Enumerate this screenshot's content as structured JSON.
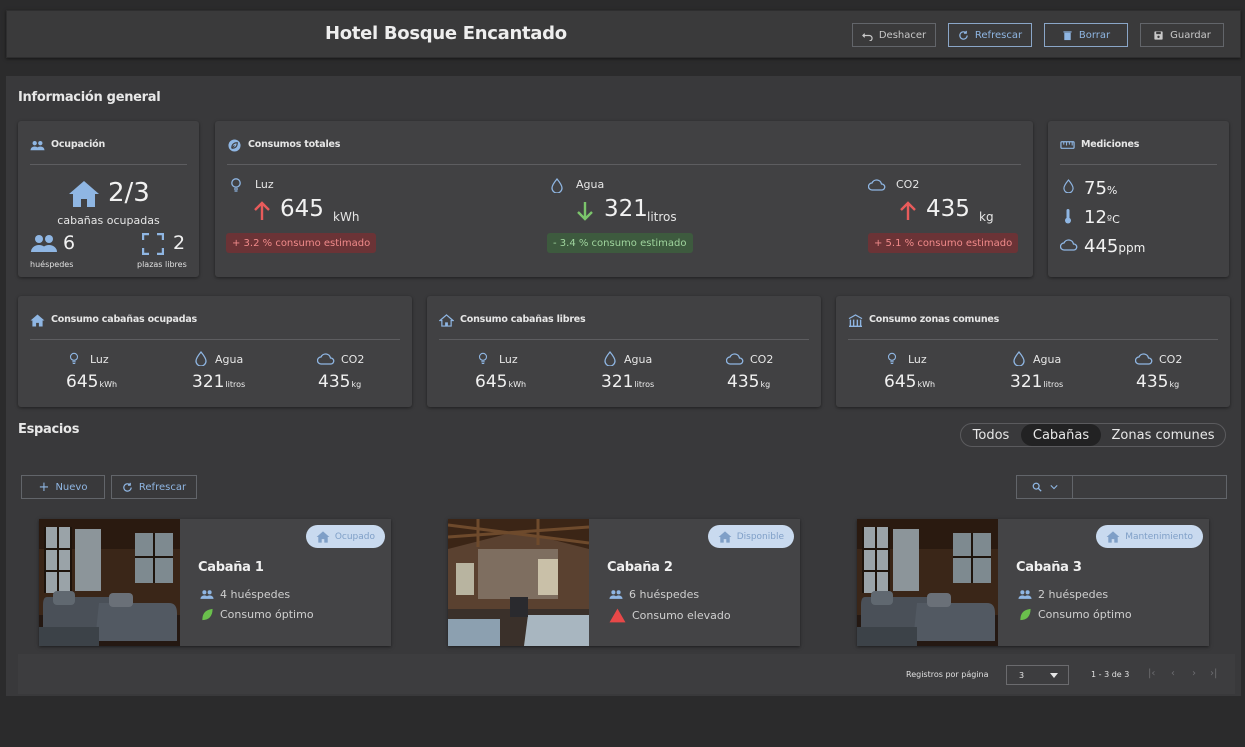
{
  "header": {
    "title": "Hotel Bosque Encantado",
    "undo": "Deshacer",
    "refresh": "Refrescar",
    "delete": "Borrar",
    "save": "Guardar"
  },
  "general": {
    "title": "Información general",
    "occupancy": {
      "title": "Ocupación",
      "cabins": "2/3",
      "cabins_label": "cabañas ocupadas",
      "guests": "6",
      "guests_label": "huéspedes",
      "free": "2",
      "free_label": "plazas libres"
    },
    "totals": {
      "title": "Consumos totales",
      "items": [
        {
          "label": "Luz",
          "value": "645",
          "unit": "kWh",
          "delta": "+ 3.2 % consumo estimado",
          "trend": "up"
        },
        {
          "label": "Agua",
          "value": "321",
          "unit": "litros",
          "delta": "- 3.4 % consumo estimado",
          "trend": "down"
        },
        {
          "label": "CO2",
          "value": "435",
          "unit": "kg",
          "delta": "+ 5.1 % consumo estimado",
          "trend": "up"
        }
      ]
    },
    "measures": {
      "title": "Mediciones",
      "humidity": "75",
      "humidity_unit": "%",
      "temp": "12",
      "temp_unit": "ºC",
      "co2": "445",
      "co2_unit": "ppm"
    },
    "groups": [
      {
        "title": "Consumo cabañas ocupadas",
        "luz": "Luz",
        "agua": "Agua",
        "co2": "CO2",
        "v1": "645",
        "u1": "kWh",
        "v2": "321",
        "u2": "litros",
        "v3": "435",
        "u3": "kg"
      },
      {
        "title": "Consumo cabañas libres",
        "luz": "Luz",
        "agua": "Agua",
        "co2": "CO2",
        "v1": "645",
        "u1": "kWh",
        "v2": "321",
        "u2": "litros",
        "v3": "435",
        "u3": "kg"
      },
      {
        "title": "Consumo zonas comunes",
        "luz": "Luz",
        "agua": "Agua",
        "co2": "CO2",
        "v1": "645",
        "u1": "kWh",
        "v2": "321",
        "u2": "litros",
        "v3": "435",
        "u3": "kg"
      }
    ]
  },
  "spaces": {
    "title": "Espacios",
    "filters": [
      "Todos",
      "Cabañas",
      "Zonas comunes"
    ],
    "active_filter": "Cabañas",
    "new_label": "Nuevo",
    "refresh_label": "Refrescar",
    "search_value": "",
    "cards": [
      {
        "name": "Cabaña 1",
        "status": "Ocupado",
        "guests": "4 huéspedes",
        "consumption": "Consumo óptimo",
        "consumption_kind": "ok"
      },
      {
        "name": "Cabaña 2",
        "status": "Disponible",
        "guests": "6 huéspedes",
        "consumption": "Consumo elevado",
        "consumption_kind": "warning"
      },
      {
        "name": "Cabaña 3",
        "status": "Mantenimiento",
        "guests": "2 huéspedes",
        "consumption": "Consumo óptimo",
        "consumption_kind": "ok"
      }
    ],
    "footer": {
      "per_page_label": "Registros por página",
      "per_page": "3",
      "range": "1 - 3 de 3"
    }
  },
  "colors": {
    "accent": "#8fb6e3",
    "up": "#e85b5b",
    "down": "#7bc46b",
    "leaf": "#6ac04c",
    "warning": "#e84848"
  },
  "icons": [
    "undo-icon",
    "refresh-icon",
    "trash-icon",
    "save-icon",
    "people-icon",
    "home-icon",
    "leaf-icon",
    "bulb-icon",
    "drop-icon",
    "cloud-icon",
    "arrow-up-icon",
    "arrow-down-icon",
    "ruler-icon",
    "thermometer-icon",
    "search-icon",
    "warning-icon"
  ]
}
